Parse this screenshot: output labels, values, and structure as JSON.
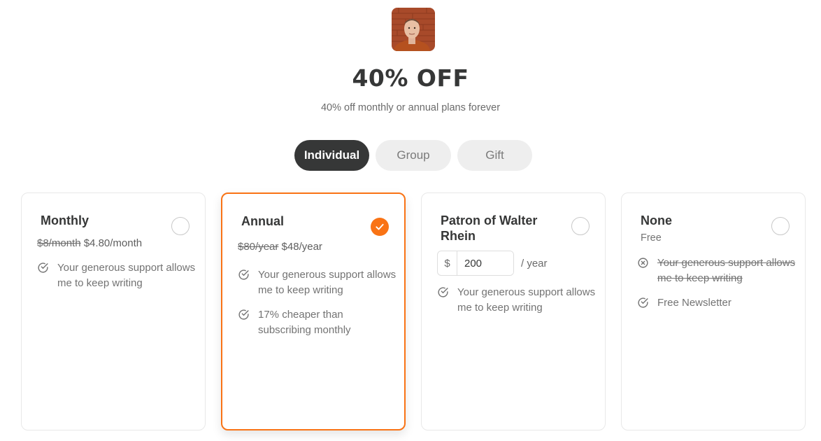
{
  "hero": {
    "headline": "40% OFF",
    "subline": "40% off monthly or annual plans forever"
  },
  "tabs": [
    {
      "label": "Individual",
      "active": true
    },
    {
      "label": "Group",
      "active": false
    },
    {
      "label": "Gift",
      "active": false
    }
  ],
  "plans": [
    {
      "title": "Monthly",
      "old_price": "$8/month",
      "new_price": "$4.80/month",
      "selected": false,
      "features": [
        {
          "text": "Your generous support allows me to keep writing",
          "icon": "check-circle-icon",
          "struck": false
        }
      ]
    },
    {
      "title": "Annual",
      "old_price": "$80/year",
      "new_price": "$48/year",
      "selected": true,
      "features": [
        {
          "text": "Your generous support allows me to keep writing",
          "icon": "check-circle-icon",
          "struck": false
        },
        {
          "text": "17% cheaper than subscribing monthly",
          "icon": "check-circle-icon",
          "struck": false
        }
      ]
    },
    {
      "title": "Patron of Walter Rhein",
      "currency_symbol": "$",
      "amount": "200",
      "amount_suffix": "/ year",
      "selected": false,
      "features": [
        {
          "text": "Your generous support allows me to keep writing",
          "icon": "check-circle-icon",
          "struck": false
        }
      ]
    },
    {
      "title": "None",
      "price_label": "Free",
      "selected": false,
      "features": [
        {
          "text": "Your generous support allows me to keep writing",
          "icon": "x-circle-icon",
          "struck": true
        },
        {
          "text": "Free Newsletter",
          "icon": "check-circle-icon",
          "struck": false
        }
      ]
    }
  ],
  "colors": {
    "accent": "#f97315",
    "dark": "#363737",
    "muted": "#737373"
  }
}
